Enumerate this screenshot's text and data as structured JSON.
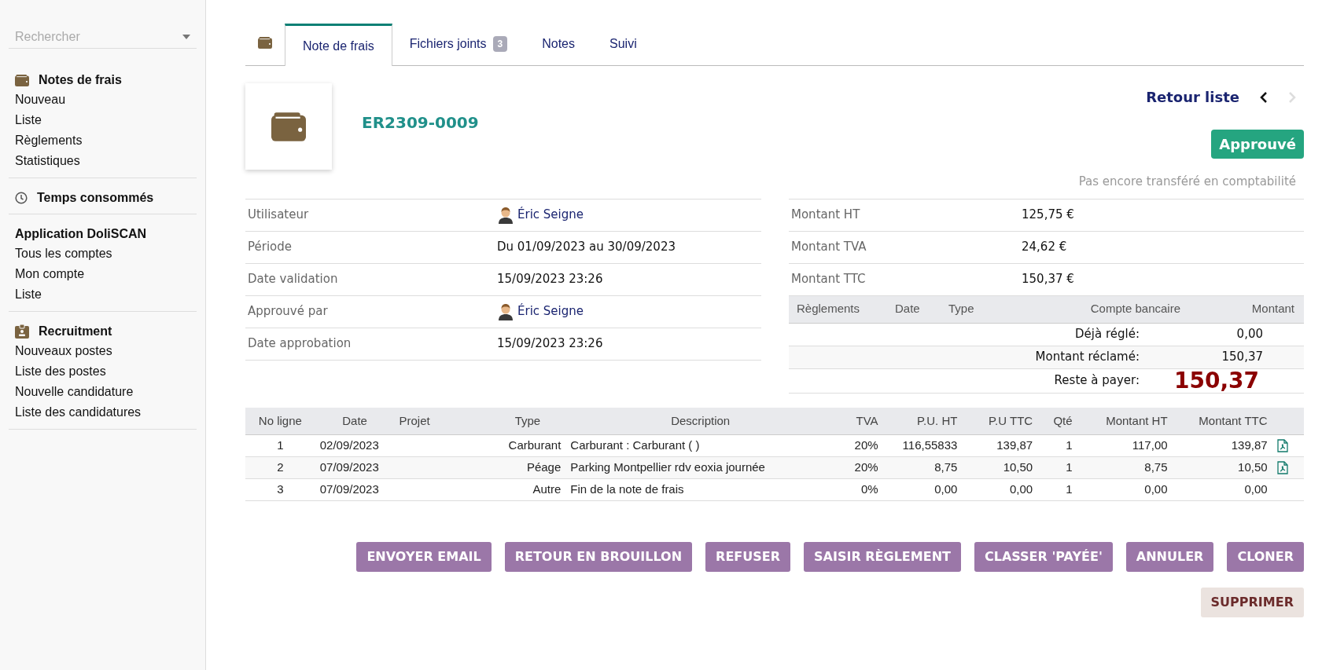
{
  "sidebar": {
    "search": {
      "placeholder": "Rechercher"
    },
    "sections": [
      {
        "title": "Notes de frais",
        "items": [
          "Nouveau",
          "Liste",
          "Règlements",
          "Statistiques"
        ]
      },
      {
        "title": "Temps consommés"
      },
      {
        "title": "Application DoliSCAN",
        "items": [
          "Tous les comptes",
          "Mon compte",
          "Liste"
        ]
      },
      {
        "title": "Recruitment",
        "items": [
          "Nouveaux postes",
          "Liste des postes",
          "Nouvelle candidature",
          "Liste des candidatures"
        ]
      }
    ]
  },
  "tabs": [
    {
      "label": "Note de frais",
      "selected": true
    },
    {
      "label": "Fichiers joints",
      "badge": "3",
      "selected": false
    },
    {
      "label": "Notes",
      "selected": false
    },
    {
      "label": "Suivi",
      "selected": false
    }
  ],
  "header": {
    "reference": "ER2309-0009",
    "back_link": "Retour liste",
    "next_disabled": true,
    "status": "Approuvé",
    "accounting_note": "Pas encore transféré en comptabilité"
  },
  "fields": [
    {
      "label": "Utilisateur",
      "value": "Éric Seigne",
      "kind": "user"
    },
    {
      "label": "Période",
      "value": "Du 01/09/2023 au 30/09/2023",
      "kind": "text"
    },
    {
      "label": "Date validation",
      "value": "15/09/2023 23:26",
      "kind": "text"
    },
    {
      "label": "Approuvé par",
      "value": "Éric Seigne",
      "kind": "user"
    },
    {
      "label": "Date approbation",
      "value": "15/09/2023 23:26",
      "kind": "text"
    }
  ],
  "totals": [
    {
      "label": "Montant HT",
      "value": "125,75 €"
    },
    {
      "label": "Montant TVA",
      "value": "24,62 €"
    },
    {
      "label": "Montant TTC",
      "value": "150,37 €"
    }
  ],
  "payments": {
    "columns": [
      "Règlements",
      "Date",
      "Type",
      "Compte bancaire",
      "Montant"
    ],
    "summary": [
      {
        "label": "Déjà réglé:",
        "value": "0,00",
        "kind": "plain"
      },
      {
        "label": "Montant réclamé:",
        "value": "150,37",
        "kind": "plain"
      },
      {
        "label": "Reste à payer:",
        "value": "150,37",
        "kind": "highlight"
      }
    ]
  },
  "lines": {
    "columns": [
      "No ligne",
      "Date",
      "Projet",
      "Type",
      "Description",
      "TVA",
      "P.U. HT",
      "P.U TTC",
      "Qté",
      "Montant HT",
      "Montant TTC"
    ],
    "rows": [
      {
        "cells": [
          "1",
          "02/09/2023",
          "",
          "Carburant",
          "Carburant : Carburant ( )",
          "20%",
          "116,55833",
          "139,87",
          "1",
          "117,00",
          "139,87"
        ],
        "attachment": true
      },
      {
        "cells": [
          "2",
          "07/09/2023",
          "",
          "Péage",
          "Parking Montpellier rdv eoxia journée",
          "20%",
          "8,75",
          "10,50",
          "1",
          "8,75",
          "10,50"
        ],
        "attachment": true
      },
      {
        "cells": [
          "3",
          "07/09/2023",
          "",
          "Autre",
          "Fin de la note de frais",
          "0%",
          "0,00",
          "0,00",
          "1",
          "0,00",
          "0,00"
        ],
        "attachment": false
      }
    ]
  },
  "actions": [
    {
      "label": "ENVOYER EMAIL",
      "kind": "action"
    },
    {
      "label": "RETOUR EN BROUILLON",
      "kind": "action"
    },
    {
      "label": "REFUSER",
      "kind": "action"
    },
    {
      "label": "SAISIR RÈGLEMENT",
      "kind": "action"
    },
    {
      "label": "CLASSER 'PAYÉE'",
      "kind": "action"
    },
    {
      "label": "ANNULER",
      "kind": "action"
    },
    {
      "label": "CLONER",
      "kind": "action"
    },
    {
      "label": "SUPPRIMER",
      "kind": "delete"
    }
  ]
}
